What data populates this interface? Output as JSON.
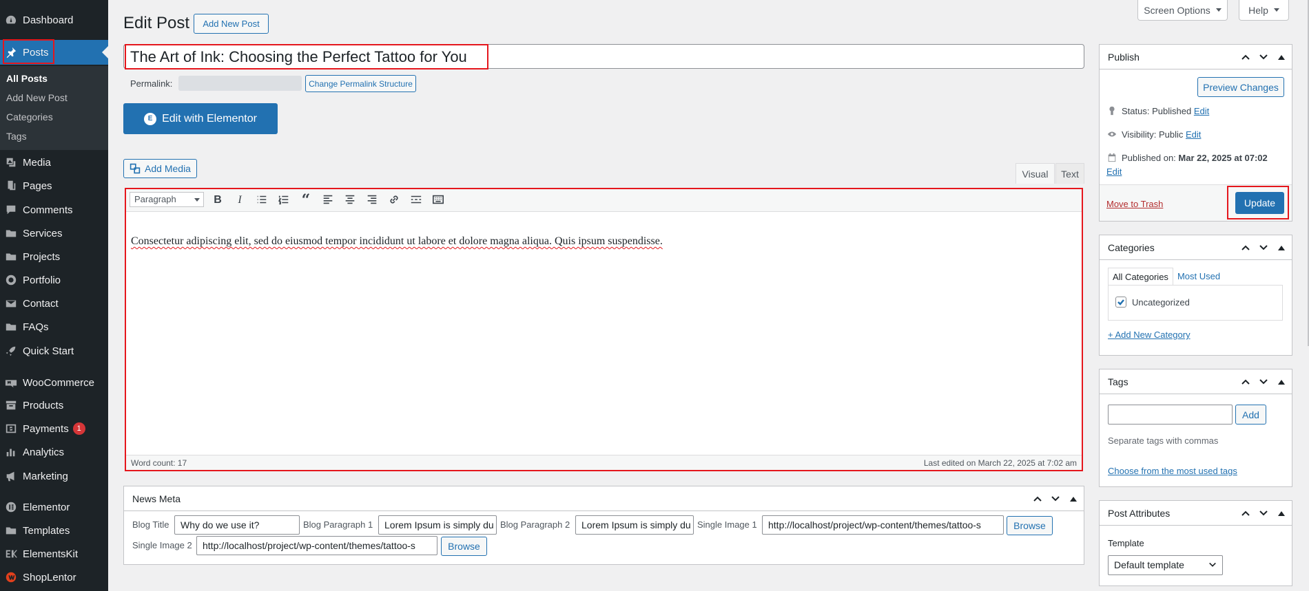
{
  "sidebar": {
    "items": [
      {
        "label": "Dashboard",
        "icon": "dashboard-icon"
      },
      {
        "label": "Posts",
        "icon": "pin-icon"
      },
      {
        "label": "Media",
        "icon": "media-icon"
      },
      {
        "label": "Pages",
        "icon": "pages-icon"
      },
      {
        "label": "Comments",
        "icon": "comments-icon"
      },
      {
        "label": "Services",
        "icon": "folder-icon"
      },
      {
        "label": "Projects",
        "icon": "folder-icon"
      },
      {
        "label": "Portfolio",
        "icon": "portfolio-icon"
      },
      {
        "label": "Contact",
        "icon": "mail-icon"
      },
      {
        "label": "FAQs",
        "icon": "folder-icon"
      },
      {
        "label": "Quick Start",
        "icon": "rocket-icon"
      },
      {
        "label": "WooCommerce",
        "icon": "woocommerce-icon"
      },
      {
        "label": "Products",
        "icon": "archive-icon"
      },
      {
        "label": "Payments",
        "icon": "payments-icon",
        "badge": "1"
      },
      {
        "label": "Analytics",
        "icon": "bar-chart-icon"
      },
      {
        "label": "Marketing",
        "icon": "megaphone-icon"
      },
      {
        "label": "Elementor",
        "icon": "elementor-icon"
      },
      {
        "label": "Templates",
        "icon": "folder-icon"
      },
      {
        "label": "ElementsKit",
        "icon": "elementskit-icon"
      },
      {
        "label": "ShopLentor",
        "icon": "shoplentor-icon"
      }
    ],
    "submenu": [
      "All Posts",
      "Add New Post",
      "Categories",
      "Tags"
    ]
  },
  "topbar": {
    "screen_options": "Screen Options",
    "help": "Help"
  },
  "header": {
    "title": "Edit Post",
    "add_new": "Add New Post"
  },
  "post": {
    "title": "The Art of Ink: Choosing the Perfect Tattoo for You",
    "permalink_label": "Permalink:",
    "change_permalink": "Change Permalink Structure",
    "elementor_button": "Edit with Elementor"
  },
  "editor": {
    "add_media": "Add Media",
    "tab_visual": "Visual",
    "tab_text": "Text",
    "format": "Paragraph",
    "content": "Consectetur adipiscing elit, sed do eiusmod tempor incididunt ut labore et dolore magna aliqua. Quis ipsum suspendisse.",
    "word_count": "Word count: 17",
    "last_edited": "Last edited on March 22, 2025 at 7:02 am"
  },
  "news_meta": {
    "title": "News Meta",
    "blog_title_label": "Blog Title",
    "blog_title_value": "Why do we use it?",
    "blog_para1_label": "Blog Paragraph 1",
    "blog_para1_value": "Lorem Ipsum is simply du",
    "blog_para2_label": "Blog Paragraph 2",
    "blog_para2_value": "Lorem Ipsum is simply du",
    "single_image1_label": "Single Image 1",
    "single_image1_value": "http://localhost/project/wp-content/themes/tattoo-s",
    "single_image2_label": "Single Image 2",
    "single_image2_value": "http://localhost/project/wp-content/themes/tattoo-s",
    "browse": "Browse"
  },
  "publish": {
    "title": "Publish",
    "preview": "Preview Changes",
    "status_label": "Status:",
    "status_value": "Published",
    "visibility_label": "Visibility:",
    "visibility_value": "Public",
    "published_on_label": "Published on:",
    "published_on_value": "Mar 22, 2025 at 07:02",
    "edit": "Edit",
    "trash": "Move to Trash",
    "update": "Update"
  },
  "categories": {
    "title": "Categories",
    "tab_all": "All Categories",
    "tab_used": "Most Used",
    "items": [
      "Uncategorized"
    ],
    "add_new": "+ Add New Category"
  },
  "tags": {
    "title": "Tags",
    "add": "Add",
    "hint": "Separate tags with commas",
    "choose": "Choose from the most used tags"
  },
  "attributes": {
    "title": "Post Attributes",
    "template_label": "Template",
    "template_value": "Default template"
  },
  "colors": {
    "accent": "#2271b1",
    "sidebar": "#1d2327",
    "highlight": "#e5161c",
    "badge": "#d63638"
  }
}
